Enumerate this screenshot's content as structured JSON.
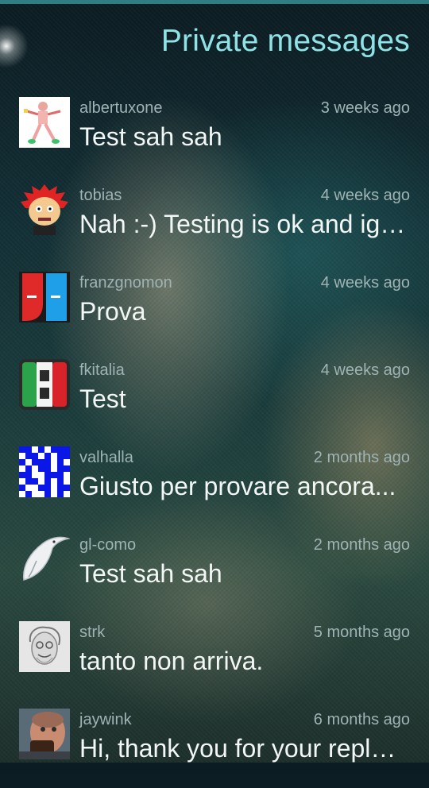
{
  "header": {
    "title": "Private messages"
  },
  "messages": [
    {
      "sender": "albertuxone",
      "time": "3 weeks ago",
      "text": "Test sah sah",
      "avatar_icon": "robot-figure-avatar"
    },
    {
      "sender": "tobias",
      "time": "4 weeks ago",
      "text": "Nah :-) Testing is ok and ig…",
      "avatar_icon": "red-hair-cartoon-avatar"
    },
    {
      "sender": "franzgnomon",
      "time": "4 weeks ago",
      "text": "Prova",
      "avatar_icon": "red-blue-logo-avatar"
    },
    {
      "sender": "fkitalia",
      "time": "4 weeks ago",
      "text": "Test",
      "avatar_icon": "italian-flag-avatar"
    },
    {
      "sender": "valhalla",
      "time": "2 months ago",
      "text": "Giusto per provare ancora...",
      "avatar_icon": "blue-pixel-pattern-avatar"
    },
    {
      "sender": "gl-como",
      "time": "2 months ago",
      "text": "Test sah sah",
      "avatar_icon": "bird-sketch-avatar"
    },
    {
      "sender": "strk",
      "time": "5 months ago",
      "text": "tanto non arriva.",
      "avatar_icon": "sketch-face-avatar"
    },
    {
      "sender": "jaywink",
      "time": "6 months ago",
      "text": "Hi, thank you for your repl…",
      "avatar_icon": "photo-face-avatar"
    }
  ],
  "colors": {
    "accent": "#8fe3e6",
    "top_bar": "#2f7f82"
  }
}
